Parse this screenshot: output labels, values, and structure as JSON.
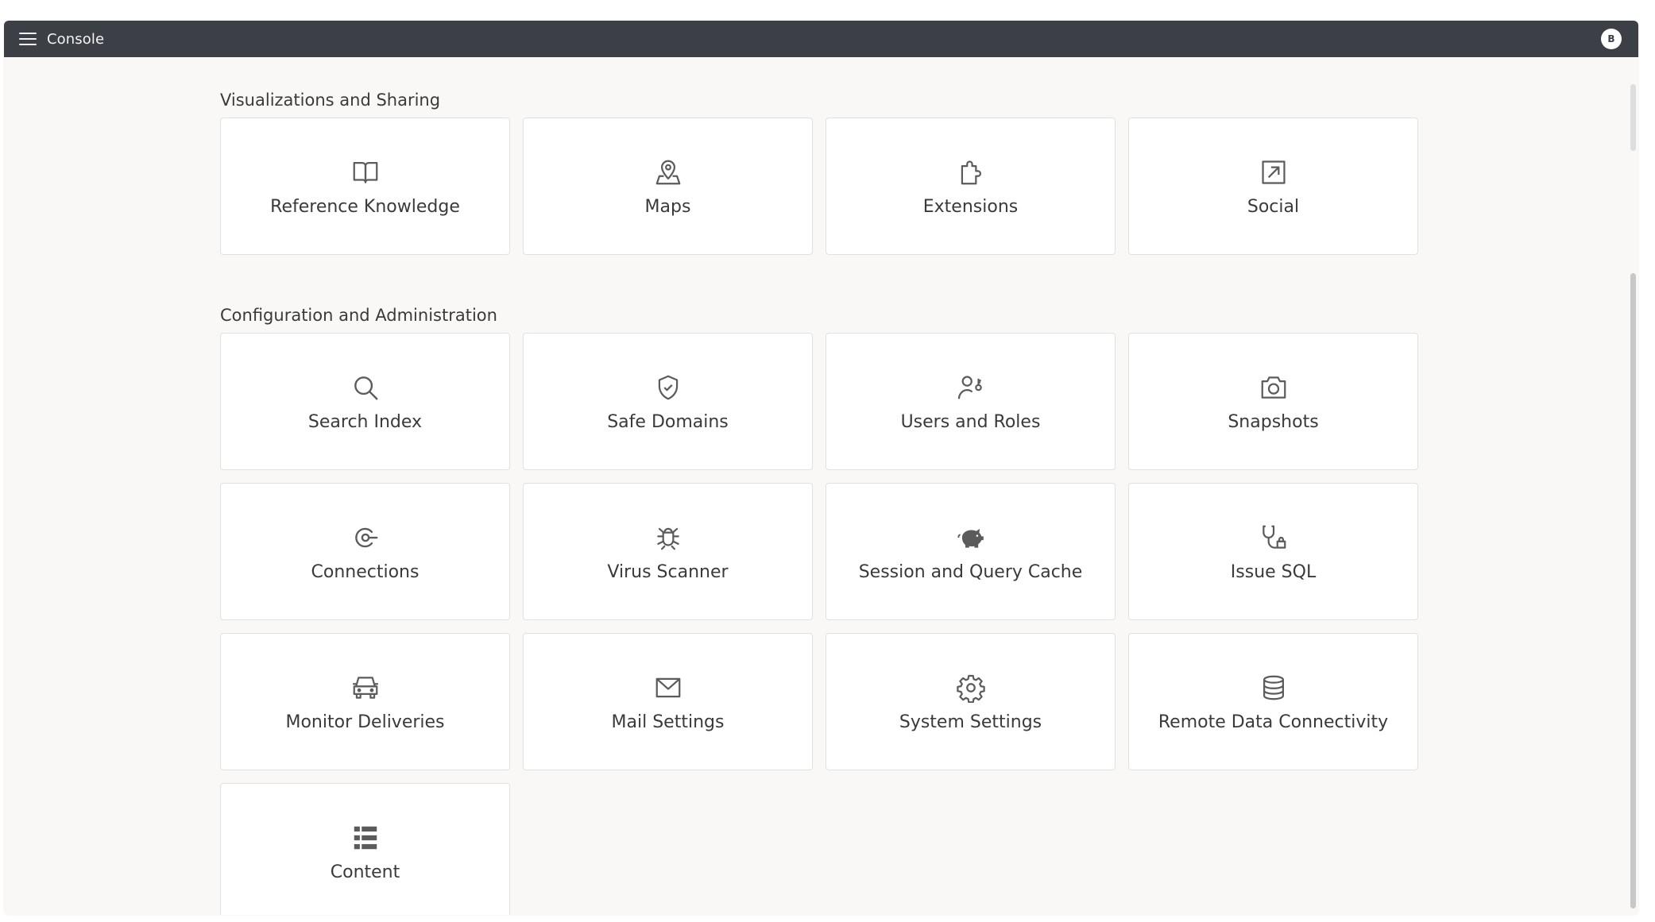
{
  "header": {
    "title": "Console",
    "avatar_initial": "B"
  },
  "sections": [
    {
      "title": "Visualizations and Sharing",
      "tiles": [
        {
          "label": "Reference Knowledge",
          "icon": "book-icon"
        },
        {
          "label": "Maps",
          "icon": "map-pin-icon"
        },
        {
          "label": "Extensions",
          "icon": "puzzle-icon"
        },
        {
          "label": "Social",
          "icon": "share-icon"
        }
      ]
    },
    {
      "title": "Configuration and Administration",
      "tiles": [
        {
          "label": "Search Index",
          "icon": "search-icon"
        },
        {
          "label": "Safe Domains",
          "icon": "shield-icon"
        },
        {
          "label": "Users and Roles",
          "icon": "user-key-icon"
        },
        {
          "label": "Snapshots",
          "icon": "camera-icon"
        },
        {
          "label": "Connections",
          "icon": "plug-icon"
        },
        {
          "label": "Virus Scanner",
          "icon": "bug-icon"
        },
        {
          "label": "Session and Query Cache",
          "icon": "piggy-bank-icon"
        },
        {
          "label": "Issue SQL",
          "icon": "stethoscope-icon"
        },
        {
          "label": "Monitor Deliveries",
          "icon": "car-icon"
        },
        {
          "label": "Mail Settings",
          "icon": "mail-icon"
        },
        {
          "label": "System Settings",
          "icon": "gear-icon"
        },
        {
          "label": "Remote Data Connectivity",
          "icon": "database-icon"
        },
        {
          "label": "Content",
          "icon": "list-icon"
        }
      ]
    }
  ],
  "colors": {
    "topbar": "#3c3f45",
    "background": "#f9f8f7",
    "tile": "#ffffff",
    "icon": "#5b5b5b"
  }
}
